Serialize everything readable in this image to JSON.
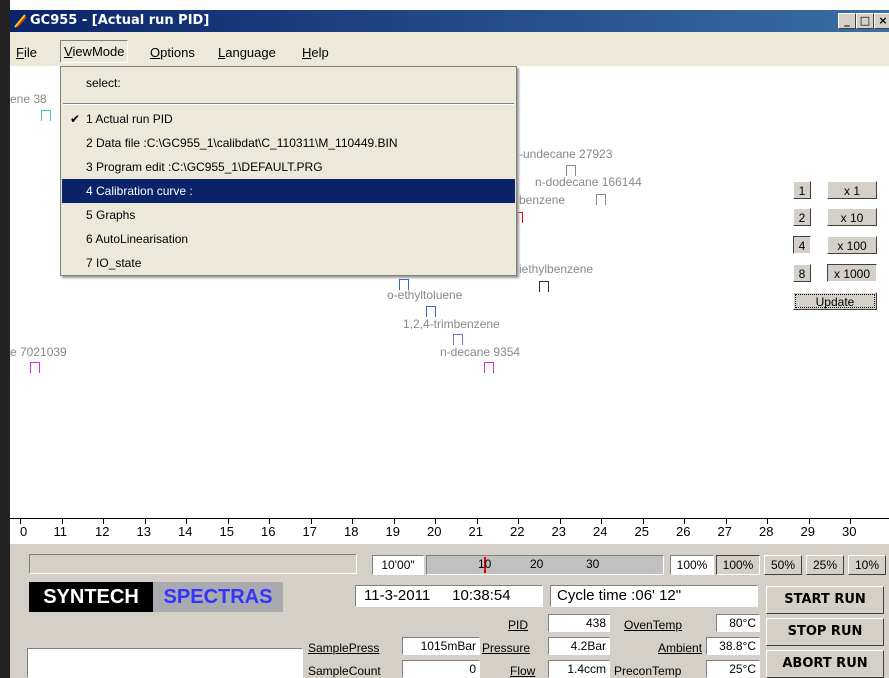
{
  "window": {
    "title": "GC955 - [Actual run PID]"
  },
  "menu": [
    {
      "label": "File",
      "key": "F",
      "rest": "ile"
    },
    {
      "label": "ViewMode",
      "key": "V",
      "rest": "iewMode"
    },
    {
      "label": "Options",
      "key": "O",
      "rest": "ptions"
    },
    {
      "label": "Language",
      "key": "L",
      "rest": "anguage"
    },
    {
      "label": "Help",
      "key": "H",
      "rest": "elp"
    }
  ],
  "dropdown": {
    "header": "select:",
    "items": [
      {
        "label": "1 Actual run PID",
        "checked": true
      },
      {
        "label": "2 Data file :C:\\GC955_1\\calibdat\\C_110311\\M_110449.BIN"
      },
      {
        "label": "3 Program edit :C:\\GC955_1\\DEFAULT.PRG"
      },
      {
        "label": "4 Calibration curve :",
        "selected": true
      },
      {
        "label": "5 Graphs"
      },
      {
        "label": "6 AutoLinearisation"
      },
      {
        "label": "7 IO_state"
      }
    ]
  },
  "peaks": [
    {
      "label": "ene 38"
    },
    {
      "label": "-undecane 27923"
    },
    {
      "label": "n-dodecane 166144"
    },
    {
      "label": "benzene"
    },
    {
      "label": "iethylbenzene"
    },
    {
      "label": "o-ethyltoluene"
    },
    {
      "label": "1,2,4-trimbenzene"
    },
    {
      "label": "n-decane 9354"
    },
    {
      "label": "e 7021039"
    }
  ],
  "axis_ticks": [
    "0",
    "11",
    "12",
    "13",
    "14",
    "15",
    "16",
    "17",
    "18",
    "19",
    "20",
    "21",
    "22",
    "23",
    "24",
    "25",
    "26",
    "27",
    "28",
    "29",
    "30"
  ],
  "scale": {
    "channels": [
      "1",
      "2",
      "4",
      "8"
    ],
    "gains": [
      "x 1",
      "x 10",
      "x 100",
      "x 1000"
    ],
    "update": "Update"
  },
  "timeline": {
    "time": "10'00\"",
    "ticks": [
      "10",
      "20",
      "30"
    ],
    "zoom": "100%",
    "zoom_buttons": [
      "100%",
      "50%",
      "25%",
      "10%"
    ]
  },
  "brand": {
    "syntech": "SYNTECH",
    "spectras": "SPECTRAS"
  },
  "status": {
    "date": "11-3-2011",
    "time": "10:38:54",
    "cycle": "Cycle time :06' 12\""
  },
  "readings": {
    "pid_label": "PID",
    "pid": "438",
    "oven_label": "OvenTemp",
    "oven": "80°C",
    "samplepress_label": "SamplePress",
    "samplepress": "1015mBar",
    "pressure_label": "Pressure",
    "pressure": "4.2Bar",
    "ambient_label": "Ambient",
    "ambient": "38.8°C",
    "samplecount_label": "SampleCount",
    "samplecount": "0",
    "flow_label": "Flow",
    "flow": "1.4ccm",
    "precon_label": "PreconTemp",
    "precon": "25°C"
  },
  "buttons": {
    "start": "START RUN",
    "stop": "STOP RUN",
    "abort": "ABORT RUN"
  },
  "colors": {
    "title_bar": "#0a246a",
    "menu_selected": "#0a246a",
    "spectras": "#3333ff"
  }
}
